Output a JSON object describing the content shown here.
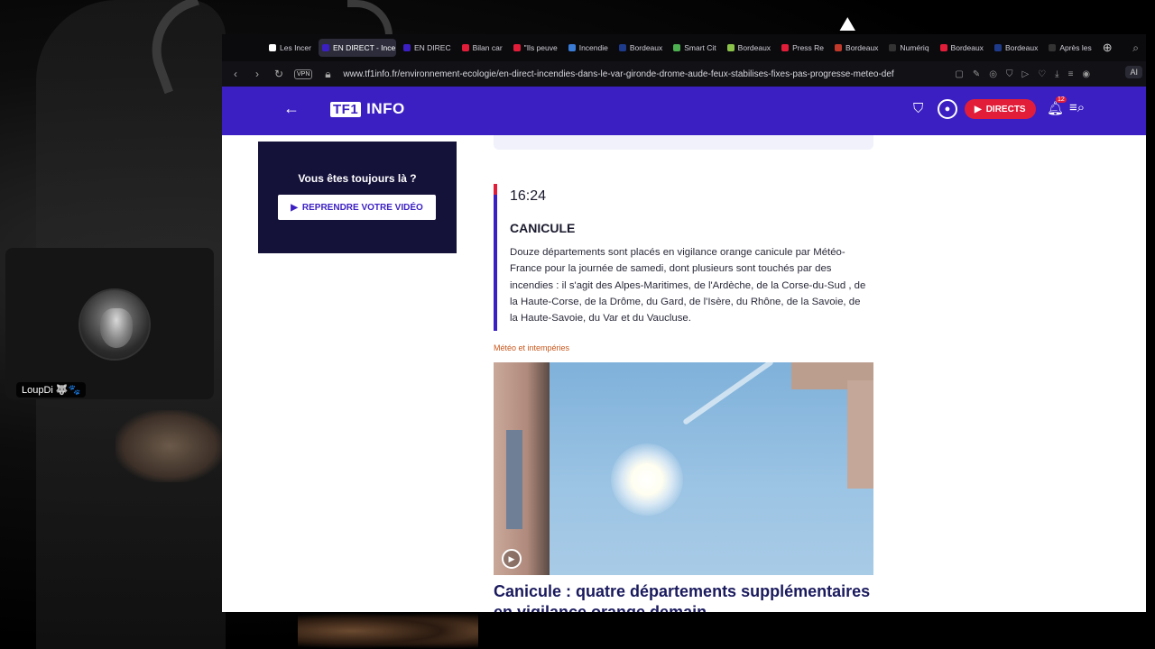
{
  "webcam": {
    "name": "LoupDi 🐺🐾"
  },
  "tabs": [
    {
      "label": "Les Incer",
      "color": "#ffffff",
      "active": false
    },
    {
      "label": "EN DIRECT - Ince",
      "color": "#3b1fc2",
      "active": true
    },
    {
      "label": "EN DIREC",
      "color": "#3b1fc2",
      "active": false
    },
    {
      "label": "Bilan car",
      "color": "#e21d3a",
      "active": false
    },
    {
      "label": "\"Ils peuve",
      "color": "#e21d3a",
      "active": false
    },
    {
      "label": "Incendie",
      "color": "#3a7bd5",
      "active": false
    },
    {
      "label": "Bordeaux",
      "color": "#1e3a8a",
      "active": false
    },
    {
      "label": "Smart Cit",
      "color": "#4caf50",
      "active": false
    },
    {
      "label": "Bordeaux",
      "color": "#8bc34a",
      "active": false
    },
    {
      "label": "Press Re",
      "color": "#e21d3a",
      "active": false
    },
    {
      "label": "Bordeaux",
      "color": "#c0392b",
      "active": false
    },
    {
      "label": "Numériq",
      "color": "#333333",
      "active": false
    },
    {
      "label": "Bordeaux",
      "color": "#e21d3a",
      "active": false
    },
    {
      "label": "Bordeaux",
      "color": "#1e3a8a",
      "active": false
    },
    {
      "label": "Après les",
      "color": "#333333",
      "active": false
    }
  ],
  "address_bar": {
    "vpn": "VPN",
    "url": "www.tf1info.fr/environnement-ecologie/en-direct-incendies-dans-le-var-gironde-drome-aude-feux-stabilises-fixes-pas-progresse-meteo-def",
    "ai_label": "AI"
  },
  "header": {
    "logo_tf1": "TF1",
    "logo_info": "INFO",
    "directs_label": "DIRECTS",
    "notification_count": "12"
  },
  "video_card": {
    "title": "Vous êtes toujours là ?",
    "button_label": "REPRENDRE VOTRE VIDÉO"
  },
  "entry": {
    "time": "16:24",
    "title": "CANICULE",
    "text": "Douze départements sont placés en vigilance orange canicule par Météo-France pour la journée de samedi, dont plusieurs sont touchés par des incendies : il s'agit des Alpes-Maritimes, de l'Ardèche, de la Corse-du-Sud , de la Haute-Corse, de la Drôme, du Gard, de l'Isère, du Rhône, de la Savoie, de la Haute-Savoie, du Var et du Vaucluse."
  },
  "article": {
    "category": "Météo et intempéries",
    "title": "Canicule : quatre départements supplémentaires en vigilance orange demain"
  },
  "colors": {
    "brand": "#3b1fc2",
    "directs": "#e21d3a",
    "category": "#c7561a"
  }
}
